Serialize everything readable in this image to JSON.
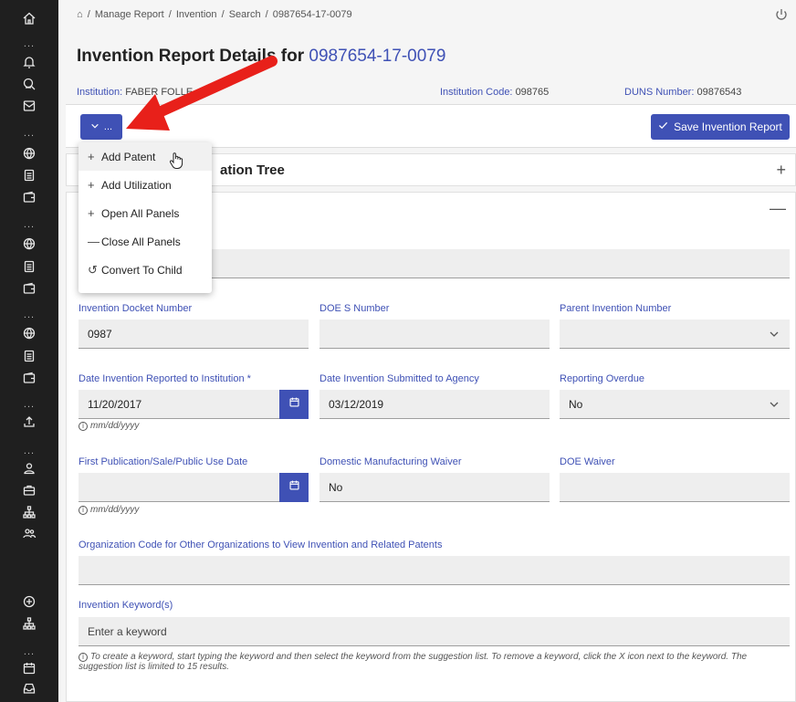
{
  "breadcrumb": {
    "items": [
      "Manage Report",
      "Invention",
      "Search",
      "0987654-17-0079"
    ],
    "sep": "/"
  },
  "page": {
    "title_prefix": "Invention Report Details for",
    "title_number": "0987654-17-0079"
  },
  "info": {
    "institution_label": "Institution:",
    "institution_value": "FABER FOLLE...",
    "code_label": "Institution Code:",
    "code_value": "098765",
    "duns_label": "DUNS Number:",
    "duns_value": "09876543"
  },
  "toolbar": {
    "menu_label": "...",
    "save_label": "Save Invention Report"
  },
  "dropdown": {
    "items": [
      {
        "icon": "+",
        "label": "Add Patent"
      },
      {
        "icon": "+",
        "label": "Add Utilization"
      },
      {
        "icon": "+",
        "label": "Open All Panels"
      },
      {
        "icon": "—",
        "label": "Close All Panels"
      },
      {
        "icon": "↺",
        "label": "Convert To Child"
      }
    ]
  },
  "panels": {
    "tree_title_partial": "ation Tree"
  },
  "form": {
    "docket_label": "Invention Docket Number",
    "docket_value": "0987",
    "doe_s_label": "DOE S Number",
    "doe_s_value": "",
    "parent_label": "Parent Invention Number",
    "parent_value": "",
    "date_reported_label": "Date Invention Reported to Institution *",
    "date_reported_value": "11/20/2017",
    "date_submitted_label": "Date Invention Submitted to Agency",
    "date_submitted_value": "03/12/2019",
    "overdue_label": "Reporting Overdue",
    "overdue_value": "No",
    "date_hint": "mm/dd/yyyy",
    "first_pub_label": "First Publication/Sale/Public Use Date",
    "first_pub_value": "",
    "waiver_label": "Domestic Manufacturing Waiver",
    "waiver_value": "No",
    "doe_waiver_label": "DOE Waiver",
    "doe_waiver_value": "",
    "org_code_label": "Organization Code for Other Organizations to View Invention and Related Patents",
    "org_code_value": "",
    "keyword_label": "Invention Keyword(s)",
    "keyword_placeholder": "Enter a keyword",
    "keyword_hint": "To create a keyword, start typing the keyword and then select the keyword from the suggestion list. To remove a keyword, click the X icon next to the keyword. The suggestion list is limited to 15 results."
  },
  "colors": {
    "accent": "#3f51b5",
    "rail": "#1f1f1f",
    "arrow": "#e8201a"
  }
}
